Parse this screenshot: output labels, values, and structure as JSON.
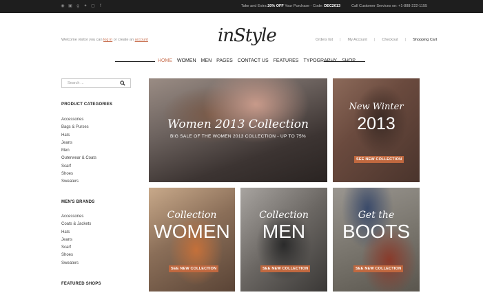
{
  "topbar": {
    "social_icons": [
      "rss-icon",
      "linkedin-icon",
      "google-plus-icon",
      "twitter-icon",
      "instagram-icon",
      "facebook-icon"
    ],
    "promo_prefix": "Take and Extra",
    "promo_bold": "20% OFF",
    "promo_middle": "Your Purchase - Code:",
    "promo_code": "DEC2013",
    "service": "Call Customer Services on: +1-888-222-1155"
  },
  "header": {
    "welcome_prefix": "Welcome visitor you can",
    "login_link": "log in",
    "welcome_middle": "or create an",
    "account_link": "account",
    "logo": "inStyle",
    "links": {
      "orders": "Orders list",
      "my_account": "My Account",
      "checkout": "Checkout",
      "cart": "Shopping Cart",
      "separator": "|"
    }
  },
  "nav": {
    "items": [
      "HOME",
      "WOMEN",
      "MEN",
      "PAGES",
      "CONTACT US",
      "FEATURES",
      "TYPOGRAPHY",
      "SHOP"
    ]
  },
  "sidebar": {
    "search_placeholder": "Search ...",
    "product_categories_title": "PRODUCT CATEGORIES",
    "product_categories": [
      "Accessories",
      "Bags & Purses",
      "Hats",
      "Jeans",
      "Men",
      "Outerwear & Coats",
      "Scarf",
      "Shoes",
      "Sweaters"
    ],
    "mens_brands_title": "MEN'S BRANDS",
    "mens_brands": [
      "Accessories",
      "Coats & Jackets",
      "Hats",
      "Jeans",
      "Scarf",
      "Shoes",
      "Sweaters"
    ],
    "featured_shops_title": "FEATURED SHOPS"
  },
  "banners": {
    "main": {
      "script": "Women 2013 Collection",
      "sub": "BIG SALE OF THE WOMEN 2013 COLLECTION - UP TO 75%"
    },
    "winter": {
      "script": "New Winter",
      "big": "2013",
      "button": "SEE NEW COLLECTION"
    },
    "women": {
      "script": "Collection",
      "big": "WOMEN",
      "button": "SEE NEW COLLECTION"
    },
    "men": {
      "script": "Collection",
      "big": "MEN",
      "button": "SEE NEW COLLECTION"
    },
    "boots": {
      "script": "Get the",
      "big": "BOOTS",
      "button": "SEE NEW COLLECTION"
    }
  },
  "colors": {
    "accent": "#c87050",
    "button": "#c0683f",
    "topbar": "#1e1e1e"
  }
}
